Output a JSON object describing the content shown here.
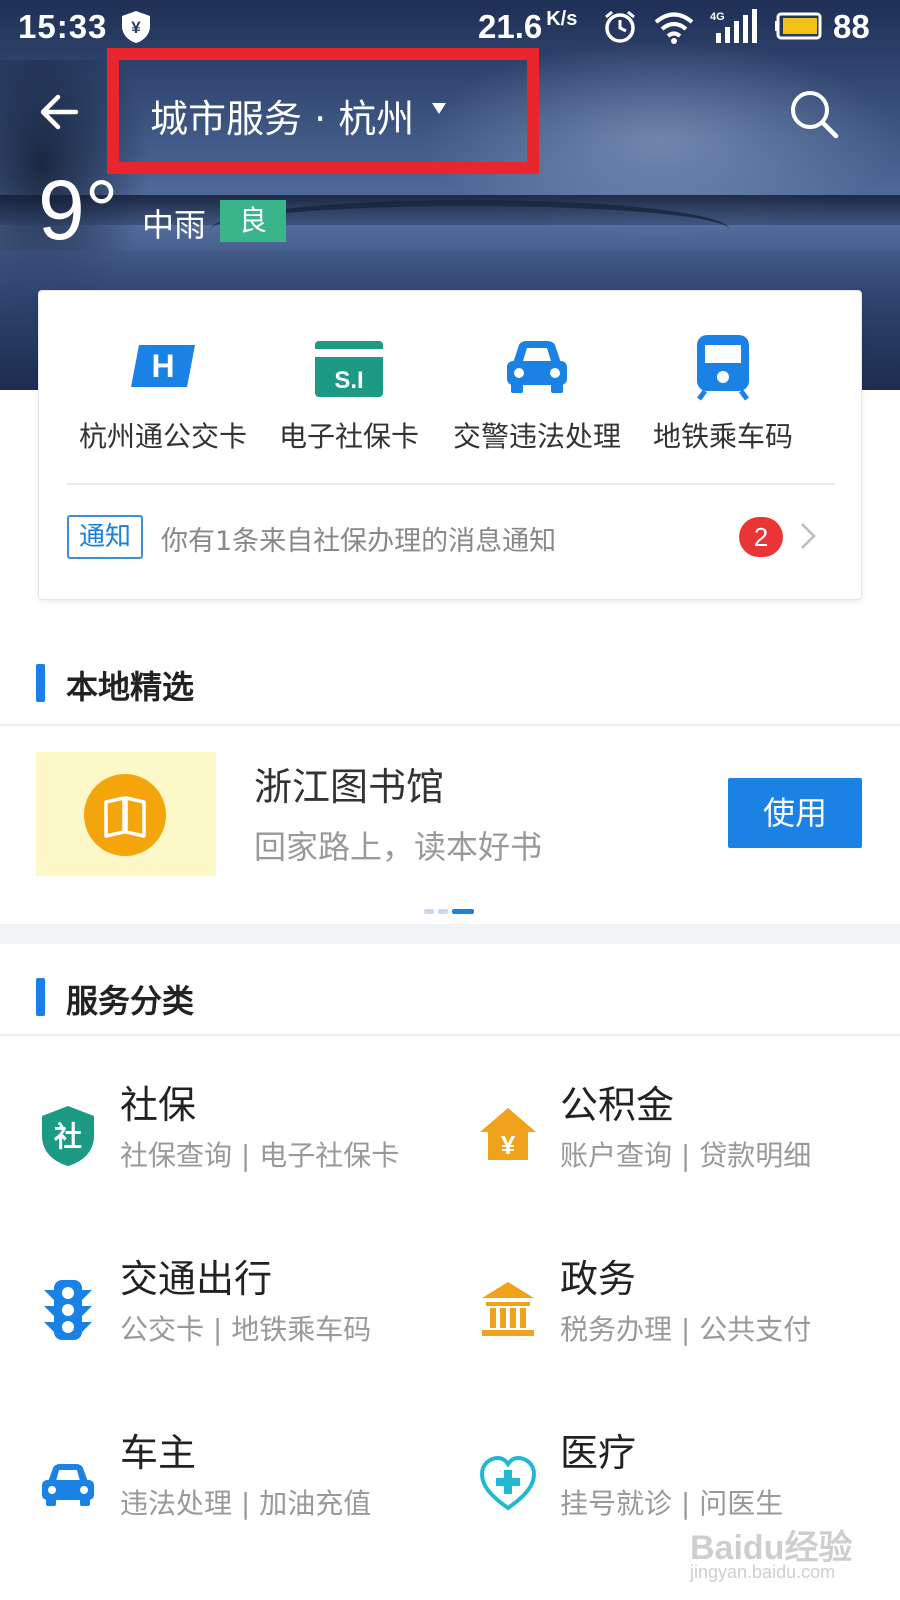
{
  "status": {
    "time": "15:33",
    "speed": "21.6",
    "speed_unit": "K/s",
    "network": "4G",
    "battery": "88"
  },
  "header": {
    "title": "城市服务 · 杭州",
    "highlight_color": "#e8262b"
  },
  "weather": {
    "temperature": "9°",
    "condition": "中雨",
    "air_quality": "良",
    "air_quality_color": "#3ab58a"
  },
  "quick_services": [
    {
      "label": "杭州通公交卡",
      "icon": "bus-card-icon",
      "icon_text": "H"
    },
    {
      "label": "电子社保卡",
      "icon": "social-security-card-icon",
      "icon_text": "S.I"
    },
    {
      "label": "交警违法处理",
      "icon": "car-icon"
    },
    {
      "label": "地铁乘车码",
      "icon": "metro-icon"
    }
  ],
  "notice": {
    "tag": "通知",
    "text": "你有1条来自社保办理的消息通知",
    "count": "2"
  },
  "local": {
    "section_title": "本地精选",
    "item_title": "浙江图书馆",
    "item_subtitle": "回家路上，读本好书",
    "button": "使用",
    "icon": "book-icon"
  },
  "categories": {
    "section_title": "服务分类",
    "items": [
      {
        "title": "社保",
        "subtitle": "社保查询 | 电子社保卡",
        "icon": "shield-icon",
        "icon_text": "社",
        "color": "#1c9a84"
      },
      {
        "title": "公积金",
        "subtitle": "账户查询 | 贷款明细",
        "icon": "house-yuan-icon",
        "icon_text": "¥",
        "color": "#f0a31a"
      },
      {
        "title": "交通出行",
        "subtitle": "公交卡 | 地铁乘车码",
        "icon": "traffic-light-icon",
        "color": "#1a82e5"
      },
      {
        "title": "政务",
        "subtitle": "税务办理 | 公共支付",
        "icon": "government-building-icon",
        "color": "#f0a31a"
      },
      {
        "title": "车主",
        "subtitle": "违法处理 | 加油充值",
        "icon": "car-icon",
        "color": "#1a82e5"
      },
      {
        "title": "医疗",
        "subtitle": "挂号就诊 | 问医生",
        "icon": "stethoscope-icon",
        "color": "#22b8d0"
      }
    ]
  },
  "watermark": {
    "text": "Baidu经验",
    "sub": "jingyan.baidu.com"
  }
}
